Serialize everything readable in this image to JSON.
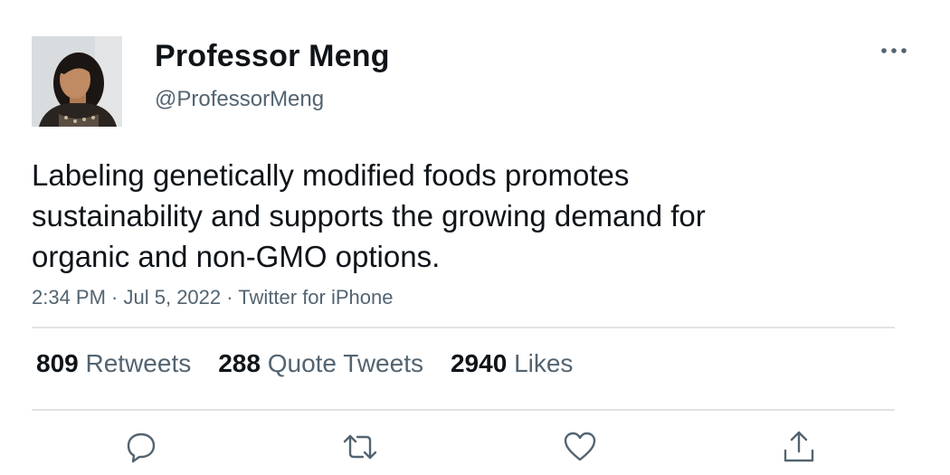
{
  "author": {
    "display_name": "Professor Meng",
    "handle": "@ProfessorMeng"
  },
  "tweet": {
    "text_lines": [
      "Labeling genetically modified foods promotes",
      "sustainability and supports the growing demand for",
      "organic and non-GMO options."
    ],
    "time": "2:34 PM",
    "separator": " · ",
    "date": "Jul 5, 2022",
    "source": "Twitter for iPhone"
  },
  "stats": {
    "retweets_count": "809",
    "retweets_label": "Retweets",
    "quotes_count": "288",
    "quotes_label": "Quote Tweets",
    "likes_count": "2940",
    "likes_label": "Likes"
  },
  "icons": {
    "more": "more-horizontal-icon",
    "reply": "reply-icon",
    "retweet": "retweet-icon",
    "like": "like-icon",
    "share": "share-icon"
  },
  "colors": {
    "text_primary": "#0f1419",
    "text_secondary": "#536471",
    "divider": "#e1e4e6"
  }
}
